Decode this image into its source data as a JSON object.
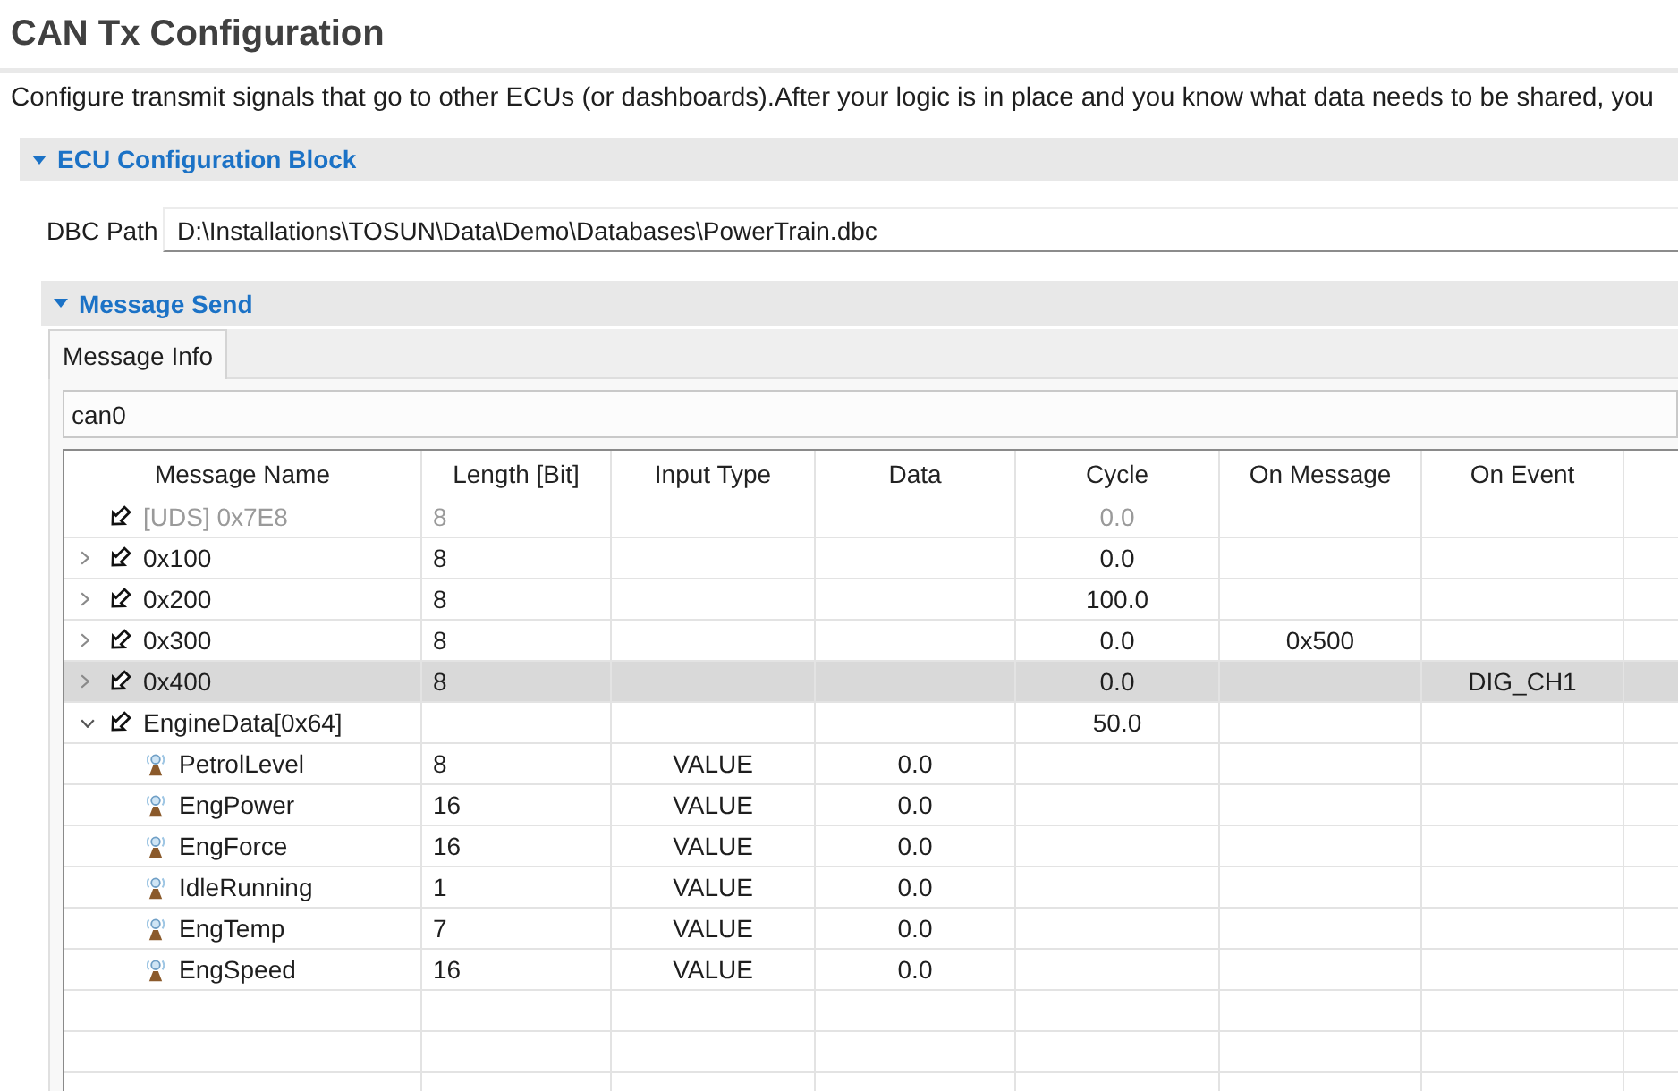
{
  "title": "CAN Tx Configuration",
  "description": "Configure transmit signals that go to other ECUs (or dashboards).After your logic is in place and you know what data needs to be shared, you",
  "ecu_section": {
    "title": "ECU Configuration Block",
    "expanded": true,
    "dbc_path": {
      "label": "DBC Path",
      "value": "D:\\Installations\\TOSUN\\Data\\Demo\\Databases\\PowerTrain.dbc"
    },
    "message_send": {
      "title": "Message Send",
      "expanded": true,
      "tabs": [
        {
          "label": "Message Info",
          "selected": true
        }
      ],
      "channel": {
        "value": "can0"
      },
      "table": {
        "columns": [
          "Message Name",
          "Length [Bit]",
          "Input Type",
          "Data",
          "Cycle",
          "On Message",
          "On Event"
        ],
        "rows": [
          {
            "name": "[UDS] 0x7E8",
            "length": "8",
            "cycle": "0.0",
            "disabled": true,
            "selected": false
          },
          {
            "name": "0x100",
            "length": "8",
            "cycle": "0.0",
            "expanded": false,
            "disabled": false,
            "selected": false
          },
          {
            "name": "0x200",
            "length": "8",
            "cycle": "100.0",
            "expanded": false,
            "disabled": false,
            "selected": false
          },
          {
            "name": "0x300",
            "length": "8",
            "cycle": "0.0",
            "on_message": "0x500",
            "expanded": false,
            "disabled": false,
            "selected": false
          },
          {
            "name": "0x400",
            "length": "8",
            "cycle": "0.0",
            "on_event": "DIG_CH1",
            "expanded": false,
            "disabled": false,
            "selected": true
          },
          {
            "name": "EngineData[0x64]",
            "cycle": "50.0",
            "expanded": true,
            "disabled": false,
            "selected": false,
            "children": [
              {
                "name": "PetrolLevel",
                "length": "8",
                "input_type": "VALUE",
                "data": "0.0",
                "selected": false
              },
              {
                "name": "EngPower",
                "length": "16",
                "input_type": "VALUE",
                "data": "0.0",
                "selected": false
              },
              {
                "name": "EngForce",
                "length": "16",
                "input_type": "VALUE",
                "data": "0.0",
                "selected": false
              },
              {
                "name": "IdleRunning",
                "length": "1",
                "input_type": "VALUE",
                "data": "0.0",
                "selected": false
              },
              {
                "name": "EngTemp",
                "length": "7",
                "input_type": "VALUE",
                "data": "0.0",
                "selected": false
              },
              {
                "name": "EngSpeed",
                "length": "16",
                "input_type": "VALUE",
                "data": "0.0",
                "selected": false
              }
            ]
          }
        ]
      }
    }
  }
}
